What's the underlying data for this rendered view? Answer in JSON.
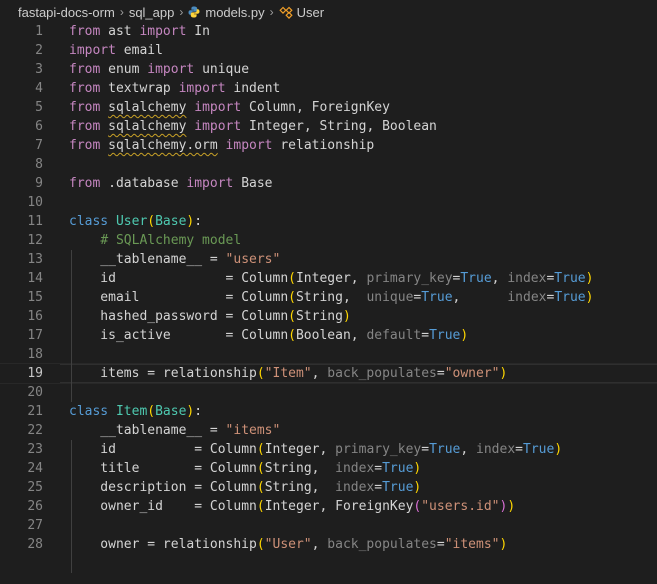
{
  "breadcrumb": {
    "items": [
      "fastapi-docs-orm",
      "sql_app",
      "models.py",
      "User"
    ],
    "separator": "›"
  },
  "editor": {
    "current_line": 19,
    "lines": [
      {
        "n": "1",
        "tokens": [
          {
            "t": "from",
            "c": "ctl"
          },
          {
            "t": " ast ",
            "c": "txt"
          },
          {
            "t": "import",
            "c": "ctl"
          },
          {
            "t": " In",
            "c": "txt"
          }
        ]
      },
      {
        "n": "2",
        "tokens": [
          {
            "t": "import",
            "c": "ctl"
          },
          {
            "t": " email",
            "c": "txt"
          }
        ]
      },
      {
        "n": "3",
        "tokens": [
          {
            "t": "from",
            "c": "ctl"
          },
          {
            "t": " enum ",
            "c": "txt"
          },
          {
            "t": "import",
            "c": "ctl"
          },
          {
            "t": " unique",
            "c": "txt"
          }
        ]
      },
      {
        "n": "4",
        "tokens": [
          {
            "t": "from",
            "c": "ctl"
          },
          {
            "t": " textwrap ",
            "c": "txt"
          },
          {
            "t": "import",
            "c": "ctl"
          },
          {
            "t": " indent",
            "c": "txt"
          }
        ]
      },
      {
        "n": "5",
        "tokens": [
          {
            "t": "from",
            "c": "ctl"
          },
          {
            "t": " ",
            "c": "txt"
          },
          {
            "t": "sqlalchemy",
            "c": "txt sq"
          },
          {
            "t": " ",
            "c": "txt"
          },
          {
            "t": "import",
            "c": "ctl"
          },
          {
            "t": " Column, ForeignKey",
            "c": "txt"
          }
        ]
      },
      {
        "n": "6",
        "tokens": [
          {
            "t": "from",
            "c": "ctl"
          },
          {
            "t": " ",
            "c": "txt"
          },
          {
            "t": "sqlalchemy",
            "c": "txt sq"
          },
          {
            "t": " ",
            "c": "txt"
          },
          {
            "t": "import",
            "c": "ctl"
          },
          {
            "t": " Integer, String, Boolean",
            "c": "txt"
          }
        ]
      },
      {
        "n": "7",
        "tokens": [
          {
            "t": "from",
            "c": "ctl"
          },
          {
            "t": " ",
            "c": "txt"
          },
          {
            "t": "sqlalchemy.orm",
            "c": "txt sq"
          },
          {
            "t": " ",
            "c": "txt"
          },
          {
            "t": "import",
            "c": "ctl"
          },
          {
            "t": " relationship",
            "c": "txt"
          }
        ]
      },
      {
        "n": "8",
        "tokens": []
      },
      {
        "n": "9",
        "tokens": [
          {
            "t": "from",
            "c": "ctl"
          },
          {
            "t": " .database ",
            "c": "txt"
          },
          {
            "t": "import",
            "c": "ctl"
          },
          {
            "t": " Base",
            "c": "txt"
          }
        ]
      },
      {
        "n": "10",
        "tokens": []
      },
      {
        "n": "11",
        "tokens": [
          {
            "t": "class",
            "c": "kw"
          },
          {
            "t": " ",
            "c": "txt"
          },
          {
            "t": "User",
            "c": "cls"
          },
          {
            "t": "(",
            "c": "br1"
          },
          {
            "t": "Base",
            "c": "cls"
          },
          {
            "t": ")",
            "c": "br1"
          },
          {
            "t": ":",
            "c": "txt"
          }
        ]
      },
      {
        "n": "12",
        "tokens": [
          {
            "t": "    ",
            "c": "txt"
          },
          {
            "t": "# SQLAlchemy model",
            "c": "cmt"
          }
        ]
      },
      {
        "n": "13",
        "tokens": [
          {
            "t": "    __tablename__ = ",
            "c": "txt"
          },
          {
            "t": "\"users\"",
            "c": "str"
          }
        ]
      },
      {
        "n": "14",
        "tokens": [
          {
            "t": "    id              = ",
            "c": "txt"
          },
          {
            "t": "Column",
            "c": "txt"
          },
          {
            "t": "(",
            "c": "br1"
          },
          {
            "t": "Integer, ",
            "c": "txt"
          },
          {
            "t": "primary_key",
            "c": "dim"
          },
          {
            "t": "=",
            "c": "txt"
          },
          {
            "t": "True",
            "c": "kw"
          },
          {
            "t": ", ",
            "c": "txt"
          },
          {
            "t": "index",
            "c": "dim"
          },
          {
            "t": "=",
            "c": "txt"
          },
          {
            "t": "True",
            "c": "kw"
          },
          {
            "t": ")",
            "c": "br1"
          }
        ]
      },
      {
        "n": "15",
        "tokens": [
          {
            "t": "    email           = ",
            "c": "txt"
          },
          {
            "t": "Column",
            "c": "txt"
          },
          {
            "t": "(",
            "c": "br1"
          },
          {
            "t": "String,  ",
            "c": "txt"
          },
          {
            "t": "unique",
            "c": "dim"
          },
          {
            "t": "=",
            "c": "txt"
          },
          {
            "t": "True",
            "c": "kw"
          },
          {
            "t": ",      ",
            "c": "txt"
          },
          {
            "t": "index",
            "c": "dim"
          },
          {
            "t": "=",
            "c": "txt"
          },
          {
            "t": "True",
            "c": "kw"
          },
          {
            "t": ")",
            "c": "br1"
          }
        ]
      },
      {
        "n": "16",
        "tokens": [
          {
            "t": "    hashed_password = ",
            "c": "txt"
          },
          {
            "t": "Column",
            "c": "txt"
          },
          {
            "t": "(",
            "c": "br1"
          },
          {
            "t": "String",
            "c": "txt"
          },
          {
            "t": ")",
            "c": "br1"
          }
        ]
      },
      {
        "n": "17",
        "tokens": [
          {
            "t": "    is_active       = ",
            "c": "txt"
          },
          {
            "t": "Column",
            "c": "txt"
          },
          {
            "t": "(",
            "c": "br1"
          },
          {
            "t": "Boolean, ",
            "c": "txt"
          },
          {
            "t": "default",
            "c": "dim"
          },
          {
            "t": "=",
            "c": "txt"
          },
          {
            "t": "True",
            "c": "kw"
          },
          {
            "t": ")",
            "c": "br1"
          }
        ]
      },
      {
        "n": "18",
        "tokens": []
      },
      {
        "n": "19",
        "tokens": [
          {
            "t": "    items = relationship",
            "c": "txt"
          },
          {
            "t": "(",
            "c": "br1"
          },
          {
            "t": "\"Item\"",
            "c": "str"
          },
          {
            "t": ", ",
            "c": "txt"
          },
          {
            "t": "back_populates",
            "c": "dim"
          },
          {
            "t": "=",
            "c": "txt"
          },
          {
            "t": "\"owner\"",
            "c": "str"
          },
          {
            "t": ")",
            "c": "br1"
          }
        ]
      },
      {
        "n": "20",
        "tokens": []
      },
      {
        "n": "21",
        "tokens": [
          {
            "t": "class",
            "c": "kw"
          },
          {
            "t": " ",
            "c": "txt"
          },
          {
            "t": "Item",
            "c": "cls"
          },
          {
            "t": "(",
            "c": "br1"
          },
          {
            "t": "Base",
            "c": "cls"
          },
          {
            "t": ")",
            "c": "br1"
          },
          {
            "t": ":",
            "c": "txt"
          }
        ]
      },
      {
        "n": "22",
        "tokens": [
          {
            "t": "    __tablename__ = ",
            "c": "txt"
          },
          {
            "t": "\"items\"",
            "c": "str"
          }
        ]
      },
      {
        "n": "23",
        "tokens": [
          {
            "t": "    id          = ",
            "c": "txt"
          },
          {
            "t": "Column",
            "c": "txt"
          },
          {
            "t": "(",
            "c": "br1"
          },
          {
            "t": "Integer, ",
            "c": "txt"
          },
          {
            "t": "primary_key",
            "c": "dim"
          },
          {
            "t": "=",
            "c": "txt"
          },
          {
            "t": "True",
            "c": "kw"
          },
          {
            "t": ", ",
            "c": "txt"
          },
          {
            "t": "index",
            "c": "dim"
          },
          {
            "t": "=",
            "c": "txt"
          },
          {
            "t": "True",
            "c": "kw"
          },
          {
            "t": ")",
            "c": "br1"
          }
        ]
      },
      {
        "n": "24",
        "tokens": [
          {
            "t": "    title       = ",
            "c": "txt"
          },
          {
            "t": "Column",
            "c": "txt"
          },
          {
            "t": "(",
            "c": "br1"
          },
          {
            "t": "String,  ",
            "c": "txt"
          },
          {
            "t": "index",
            "c": "dim"
          },
          {
            "t": "=",
            "c": "txt"
          },
          {
            "t": "True",
            "c": "kw"
          },
          {
            "t": ")",
            "c": "br1"
          }
        ]
      },
      {
        "n": "25",
        "tokens": [
          {
            "t": "    description = ",
            "c": "txt"
          },
          {
            "t": "Column",
            "c": "txt"
          },
          {
            "t": "(",
            "c": "br1"
          },
          {
            "t": "String,  ",
            "c": "txt"
          },
          {
            "t": "index",
            "c": "dim"
          },
          {
            "t": "=",
            "c": "txt"
          },
          {
            "t": "True",
            "c": "kw"
          },
          {
            "t": ")",
            "c": "br1"
          }
        ]
      },
      {
        "n": "26",
        "tokens": [
          {
            "t": "    owner_id    = ",
            "c": "txt"
          },
          {
            "t": "Column",
            "c": "txt"
          },
          {
            "t": "(",
            "c": "br1"
          },
          {
            "t": "Integer, ForeignKey",
            "c": "txt"
          },
          {
            "t": "(",
            "c": "br2"
          },
          {
            "t": "\"users.id\"",
            "c": "str"
          },
          {
            "t": ")",
            "c": "br2"
          },
          {
            "t": ")",
            "c": "br1"
          }
        ]
      },
      {
        "n": "27",
        "tokens": []
      },
      {
        "n": "28",
        "tokens": [
          {
            "t": "    owner = relationship",
            "c": "txt"
          },
          {
            "t": "(",
            "c": "br1"
          },
          {
            "t": "\"User\"",
            "c": "str"
          },
          {
            "t": ", ",
            "c": "txt"
          },
          {
            "t": "back_populates",
            "c": "dim"
          },
          {
            "t": "=",
            "c": "txt"
          },
          {
            "t": "\"items\"",
            "c": "str"
          },
          {
            "t": ")",
            "c": "br1"
          }
        ]
      }
    ]
  },
  "icons": {
    "file": "python-file-icon",
    "symbol": "class-symbol-icon"
  },
  "colors": {
    "background": "#1e1e1e",
    "keyword": "#569cd6",
    "control": "#c586c0",
    "class": "#4ec9b0",
    "string": "#ce9178",
    "comment": "#6a9955",
    "bracket": "#ffd700",
    "bracket2": "#da70d6",
    "line_number": "#858585"
  }
}
